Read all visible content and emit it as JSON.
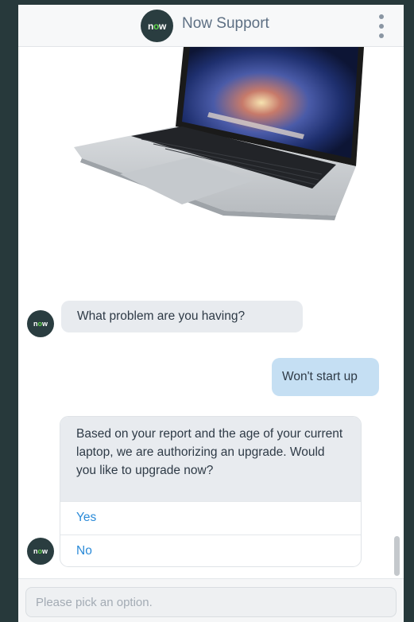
{
  "header": {
    "logo_prefix": "n",
    "logo_o": "o",
    "logo_suffix": "w",
    "title": "Now Support",
    "menu_icon": "kebab-menu-icon"
  },
  "avatar": {
    "prefix": "n",
    "o": "o",
    "suffix": "w"
  },
  "messages": {
    "bot_question": "What problem are you having?",
    "user_reply": "Won't start up",
    "bot_card": {
      "text": "Based on your report and the age of your current laptop, we are authorizing an upgrade. Would you like to upgrade now?",
      "options": [
        "Yes",
        "No"
      ]
    }
  },
  "composer": {
    "placeholder": "Please pick an option."
  },
  "colors": {
    "brand_dark": "#2a3d40",
    "brand_green": "#62d84e",
    "user_bubble": "#c5dff3",
    "bot_bubble": "#e8ebef",
    "link": "#2a8ad8"
  }
}
